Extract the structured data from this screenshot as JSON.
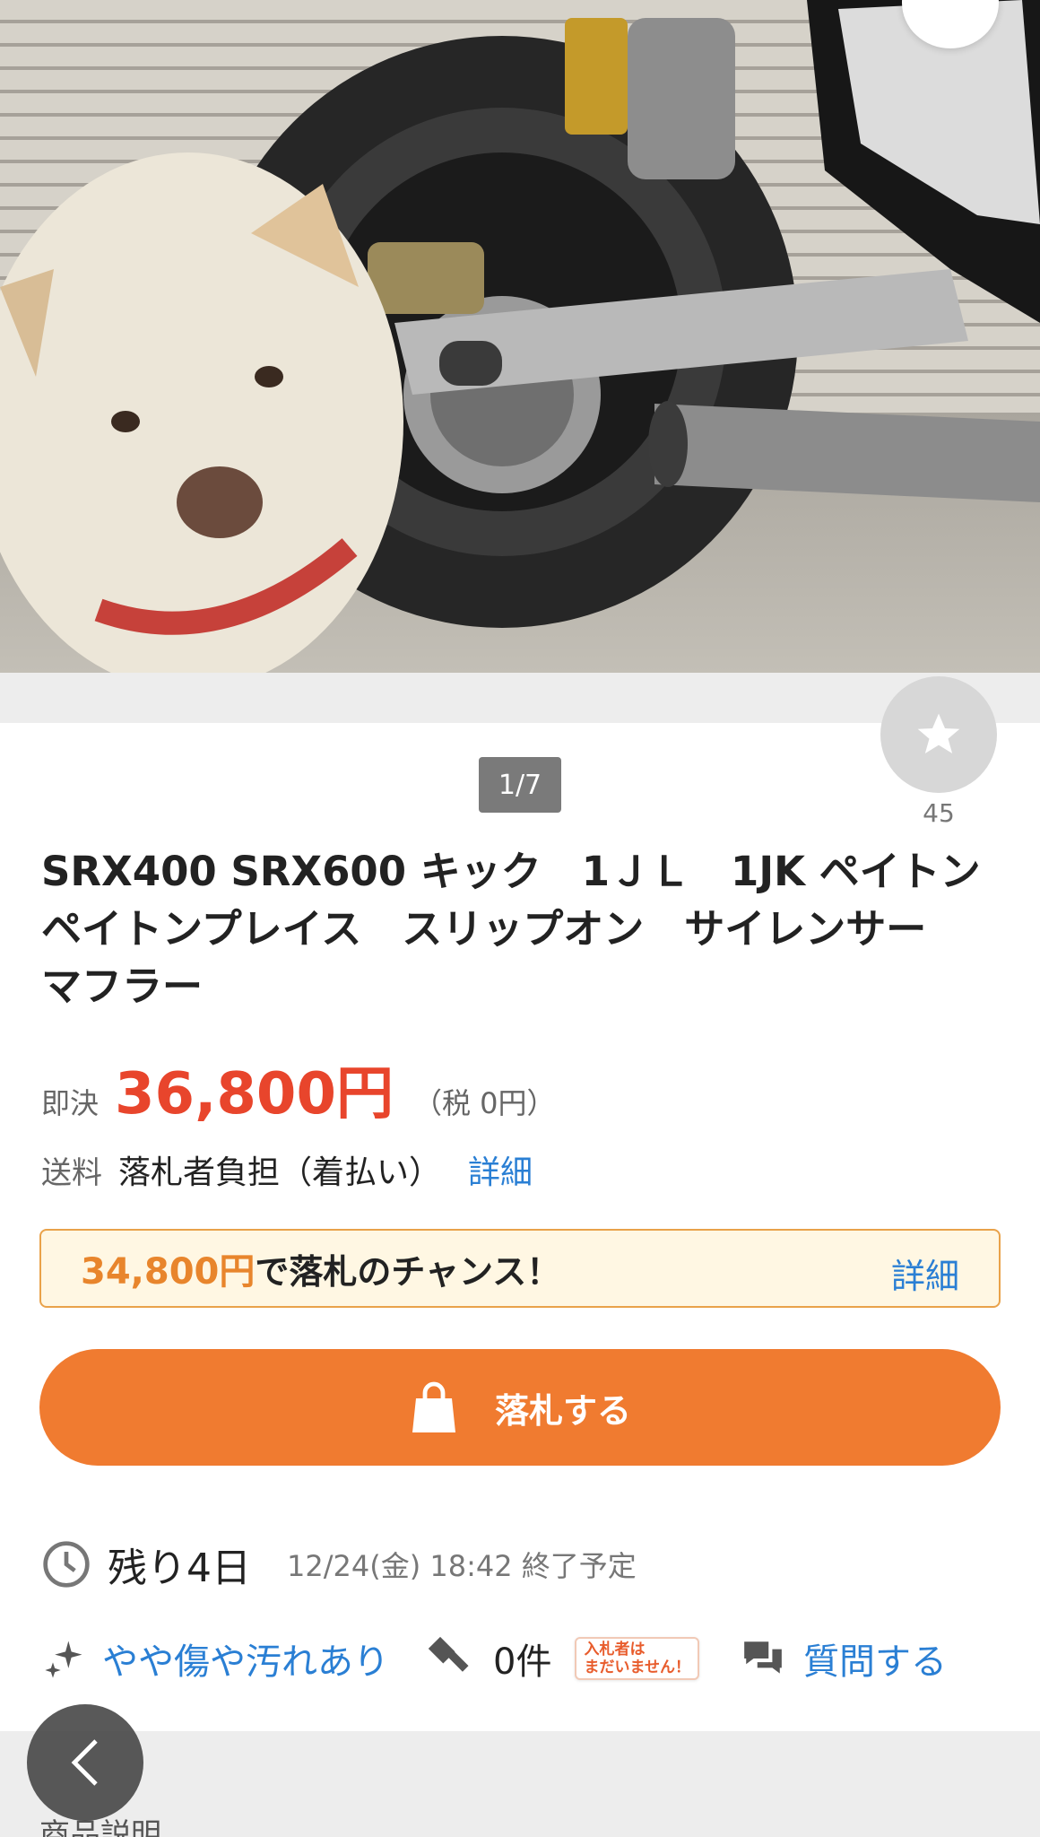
{
  "header": {
    "more_icon_label": "•••"
  },
  "gallery": {
    "pager": "1/7",
    "watch_count": "45"
  },
  "item": {
    "title": "SRX400 SRX600 キック　1ＪＬ　1JK ペイトン　ペイトンプレイス　スリップオン　サイレンサー　マフラー"
  },
  "price": {
    "label": "即決",
    "value": "36,800円",
    "tax": "（税 0円）"
  },
  "shipping": {
    "label": "送料",
    "value": "落札者負担（着払い）",
    "link": "詳細"
  },
  "chance": {
    "price": "34,800円",
    "text": "で落札のチャンス！",
    "link": "詳細"
  },
  "bid_button": {
    "label": "落札する"
  },
  "time": {
    "remaining": "残り4日",
    "end": "12/24(金) 18:42 終了予定"
  },
  "info": {
    "condition": "やや傷や汚れあり",
    "bid_count": "0件",
    "no_bid_tag_line1": "入札者は",
    "no_bid_tag_line2": "まだいません！",
    "question": "質問する"
  },
  "section": {
    "description_label": "商品説明"
  },
  "colors": {
    "accent_orange": "#f07b30",
    "price_red": "#e8452c",
    "link_blue": "#2a7fd4"
  }
}
